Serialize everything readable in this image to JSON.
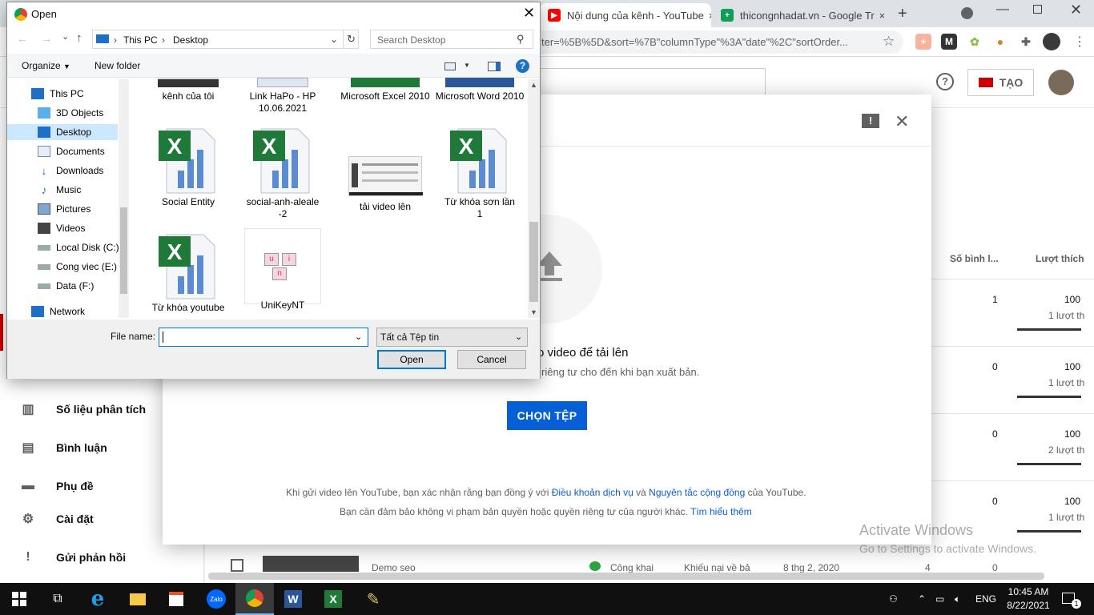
{
  "browser": {
    "tabs": [
      {
        "title": "Nội dung của kênh - YouTube",
        "close": "×"
      },
      {
        "title": "thicongnhadat.vn - Google Tr",
        "close": "×"
      }
    ],
    "new_tab": "+",
    "url": "ter=%5B%5D&sort=%7B\"columnType\"%3A\"date\"%2C\"sortOrder..."
  },
  "youtube": {
    "create_label": "TẠO",
    "sidebar": [
      {
        "label": "Số liệu phân tích",
        "icon": "analytics-icon"
      },
      {
        "label": "Bình luận",
        "icon": "comments-icon"
      },
      {
        "label": "Phụ đề",
        "icon": "subtitles-icon"
      },
      {
        "label": "Cài đặt",
        "icon": "settings-icon"
      },
      {
        "label": "Gửi phản hồi",
        "icon": "feedback-icon"
      }
    ],
    "table": {
      "col_comments": "Số bình l...",
      "col_likes": "Lượt thích",
      "rows": [
        {
          "comments": "1",
          "likes": "100",
          "likes_sub": "1 lượt th"
        },
        {
          "comments": "0",
          "likes": "100",
          "likes_sub": "1 lượt th"
        },
        {
          "comments": "0",
          "likes": "100",
          "likes_sub": "2 lượt th"
        },
        {
          "comments": "0",
          "likes": "100",
          "likes_sub": "1 lượt th"
        }
      ],
      "partial_row": {
        "title": "Demo seo",
        "visibility": "Công khai",
        "restriction": "Khiếu nại về bả",
        "date": "8 thg 2, 2020",
        "views": "4",
        "comments": "0"
      }
    }
  },
  "upload_modal": {
    "heading": "o video để tải lên",
    "subheading": "riêng tư cho đến khi bạn xuất bản.",
    "choose_button": "CHỌN TỆP",
    "terms_prefix": "Khi gửi video lên YouTube, bạn xác nhận rằng bạn đồng ý với",
    "terms_link": "Điều khoản dịch vụ",
    "terms_and": "và",
    "guidelines_link": "Nguyên tắc cộng đồng",
    "terms_suffix": "của YouTube.",
    "copyright_text": "Bạn cần đảm bảo không vi phạm bản quyền hoặc quyền riêng tư của người khác.",
    "learn_more": "Tìm hiểu thêm"
  },
  "watermark": {
    "line1": "Activate Windows",
    "line2": "Go to Settings to activate Windows."
  },
  "dialog": {
    "title": "Open",
    "breadcrumb": [
      "This PC",
      "Desktop"
    ],
    "search_placeholder": "Search Desktop",
    "organize": "Organize",
    "new_folder": "New folder",
    "help": "?",
    "nav": [
      {
        "label": "This PC",
        "icon": "pc-icon"
      },
      {
        "label": "3D Objects",
        "icon": "3d-objects-icon"
      },
      {
        "label": "Desktop",
        "icon": "desktop-icon",
        "selected": true
      },
      {
        "label": "Documents",
        "icon": "documents-icon"
      },
      {
        "label": "Downloads",
        "icon": "downloads-icon"
      },
      {
        "label": "Music",
        "icon": "music-icon"
      },
      {
        "label": "Pictures",
        "icon": "pictures-icon"
      },
      {
        "label": "Videos",
        "icon": "videos-icon"
      },
      {
        "label": "Local Disk (C:)",
        "icon": "drive-icon"
      },
      {
        "label": "Cong viec (E:)",
        "icon": "drive-icon"
      },
      {
        "label": "Data (F:)",
        "icon": "drive-icon"
      },
      {
        "label": "Network",
        "icon": "network-icon"
      }
    ],
    "files_top": [
      {
        "name": "kênh của tôi"
      },
      {
        "name": "Link HaPo -  HP 10.06.2021"
      },
      {
        "name": "Microsoft Excel 2010"
      },
      {
        "name": "Microsoft Word 2010"
      }
    ],
    "files": [
      {
        "name": "Social Entity",
        "type": "excel"
      },
      {
        "name": "social-anh-aleale-2",
        "type": "excel"
      },
      {
        "name": "tải video lên",
        "type": "image"
      },
      {
        "name": "Từ khóa sơn lần 1",
        "type": "excel"
      },
      {
        "name": "Từ khóa youtube",
        "type": "excel"
      },
      {
        "name": "UniKeyNT",
        "type": "app"
      }
    ],
    "filename_label": "File name:",
    "filename_value": "",
    "filetype": "Tất cả Tệp tin",
    "open_button": "Open",
    "cancel_button": "Cancel"
  },
  "taskbar": {
    "language": "ENG",
    "time": "10:45 AM",
    "date": "8/22/2021",
    "notifications": "1"
  }
}
